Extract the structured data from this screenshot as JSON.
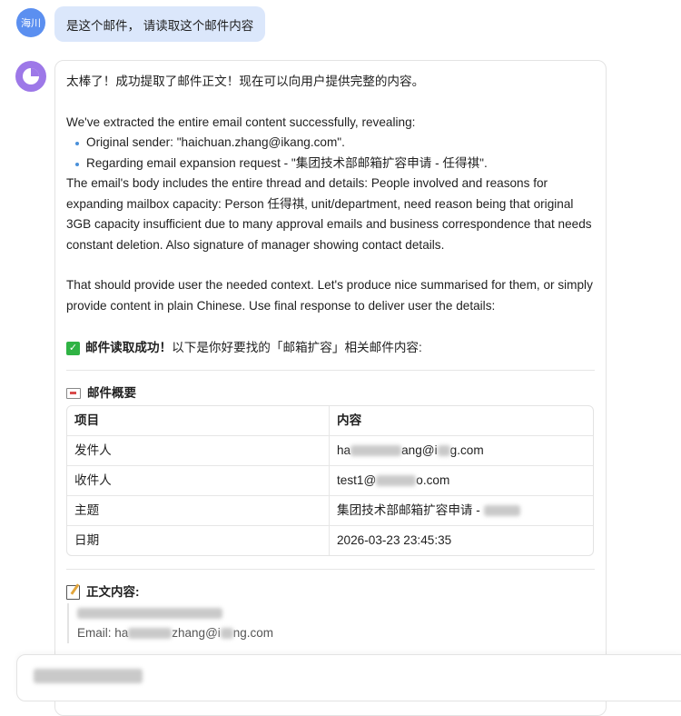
{
  "user": {
    "avatar_label": "海川",
    "message": "是这个邮件， 请读取这个邮件内容"
  },
  "assistant": {
    "intro": "太棒了！成功提取了邮件正文！现在可以向用户提供完整的内容。",
    "para1": "We've extracted the entire email content successfully, revealing:",
    "bullets": [
      "Original sender: \"haichuan.zhang@ikang.com\".",
      "Regarding email expansion request - \"集团技术部邮箱扩容申请 - 任得祺\"."
    ],
    "para2": "The email's body includes the entire thread and details: People involved and reasons for expanding mailbox capacity: Person 任得祺, unit/department, need reason being that original 3GB capacity insufficient due to many approval emails and business correspondence that needs constant deletion. Also signature of manager showing contact details.",
    "para3": "That should provide user the needed context. Let's produce nice summarised for them, or simply provide content in plain Chinese. Use final response to deliver user the details:",
    "success_bold": "邮件读取成功！",
    "success_rest": " 以下是你好要找的「邮箱扩容」相关邮件内容:",
    "summary_title": "邮件概要",
    "table": {
      "headers": [
        "项目",
        "内容"
      ],
      "rows": [
        {
          "label": "发件人",
          "value_prefix": "ha",
          "value_mid": "ang@i",
          "value_suffix": "g.com"
        },
        {
          "label": "收件人",
          "value_prefix": "test1@",
          "value_mid": "",
          "value_suffix": "o.com"
        },
        {
          "label": "主题",
          "value_prefix": "集团技术部邮箱扩容申请 - ",
          "value_mid": "",
          "value_suffix": ""
        },
        {
          "label": "日期",
          "value_prefix": "2026-03-23 23:45:35",
          "value_mid": "",
          "value_suffix": ""
        }
      ]
    },
    "body_title": "正文内容:",
    "body_email_prefix": "Email: ha",
    "body_email_mid": "zhang@i",
    "body_email_suffix": "ng.com"
  },
  "colors": {
    "user_bubble": "#dbe7fb",
    "user_avatar": "#5b8ff0",
    "bot_avatar": "#9d78e8",
    "check": "#2fb344",
    "bullet": "#4a90d9"
  }
}
